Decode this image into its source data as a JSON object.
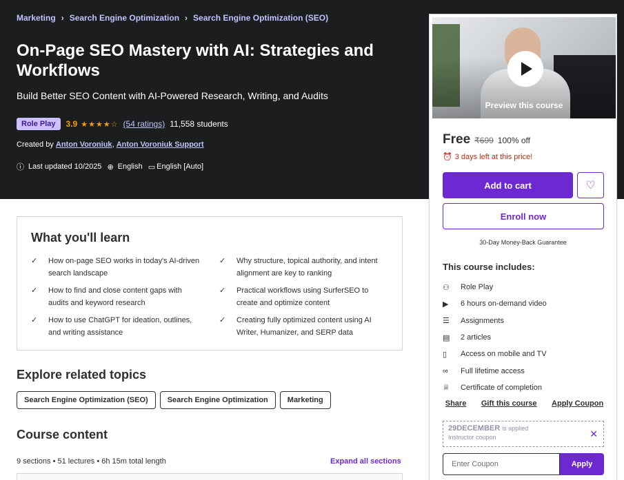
{
  "breadcrumb": [
    "Marketing",
    "Search Engine Optimization",
    "Search Engine Optimization (SEO)"
  ],
  "breadcrumb_separator": "›",
  "course": {
    "title": "On-Page SEO Mastery with AI: Strategies and Workflows",
    "subtitle": "Build Better SEO Content with AI-Powered Research, Writing, and Audits",
    "badge": "Role Play",
    "rating": "3.9",
    "stars": "★★★★☆",
    "ratings_link": "(54 ratings)",
    "students": "11,558 students",
    "created_by_label": "Created by",
    "instructors": [
      "Anton Voroniuk",
      "Anton Voroniuk Support"
    ],
    "instructor_separator": ",",
    "last_updated": "Last updated 10/2025",
    "language": "English",
    "captions": "English [Auto]"
  },
  "sidebar": {
    "preview_label": "Preview this course",
    "price": "Free",
    "original_price": "₹699",
    "discount": "100% off",
    "timer": "3 days left at this price!",
    "add_to_cart": "Add to cart",
    "enroll": "Enroll now",
    "guarantee": "30-Day Money-Back Guarantee",
    "includes_title": "This course includes:",
    "includes": [
      {
        "icon": "role-play-icon",
        "glyph": "⚇",
        "label": "Role Play"
      },
      {
        "icon": "video-icon",
        "glyph": "▶",
        "label": "6 hours on-demand video"
      },
      {
        "icon": "assignment-icon",
        "glyph": "☰",
        "label": "Assignments"
      },
      {
        "icon": "article-icon",
        "glyph": "▤",
        "label": "2 articles"
      },
      {
        "icon": "mobile-icon",
        "glyph": "▯",
        "label": "Access on mobile and TV"
      },
      {
        "icon": "infinity-icon",
        "glyph": "∞",
        "label": "Full lifetime access"
      },
      {
        "icon": "trophy-icon",
        "glyph": "♕",
        "label": "Certificate of completion"
      }
    ],
    "links": [
      "Share",
      "Gift this course",
      "Apply Coupon"
    ],
    "coupon": {
      "code": "29DECEMBER",
      "applied_text": "is applied",
      "sub": "Instructor coupon",
      "input_placeholder": "Enter Coupon",
      "apply": "Apply"
    }
  },
  "learn": {
    "title": "What you'll learn",
    "items": [
      "How on-page SEO works in today's AI-driven search landscape",
      "Why structure, topical authority, and intent alignment are key to ranking",
      "How to find and close content gaps with audits and keyword research",
      "Practical workflows using SurferSEO to create and optimize content",
      "How to use ChatGPT for ideation, outlines, and writing assistance",
      "Creating fully optimized content using AI Writer, Humanizer, and SERP data"
    ]
  },
  "topics": {
    "title": "Explore related topics",
    "items": [
      "Search Engine Optimization (SEO)",
      "Search Engine Optimization",
      "Marketing"
    ]
  },
  "content": {
    "title": "Course content",
    "meta": "9 sections • 51 lectures • 6h 15m total length",
    "expand_all": "Expand all sections"
  },
  "colors": {
    "hero_bg": "#1c1d1f",
    "accent": "#6d28d2",
    "link_light": "#c0c4fc",
    "star": "#f69c08",
    "timer_red": "#b32d0f"
  }
}
